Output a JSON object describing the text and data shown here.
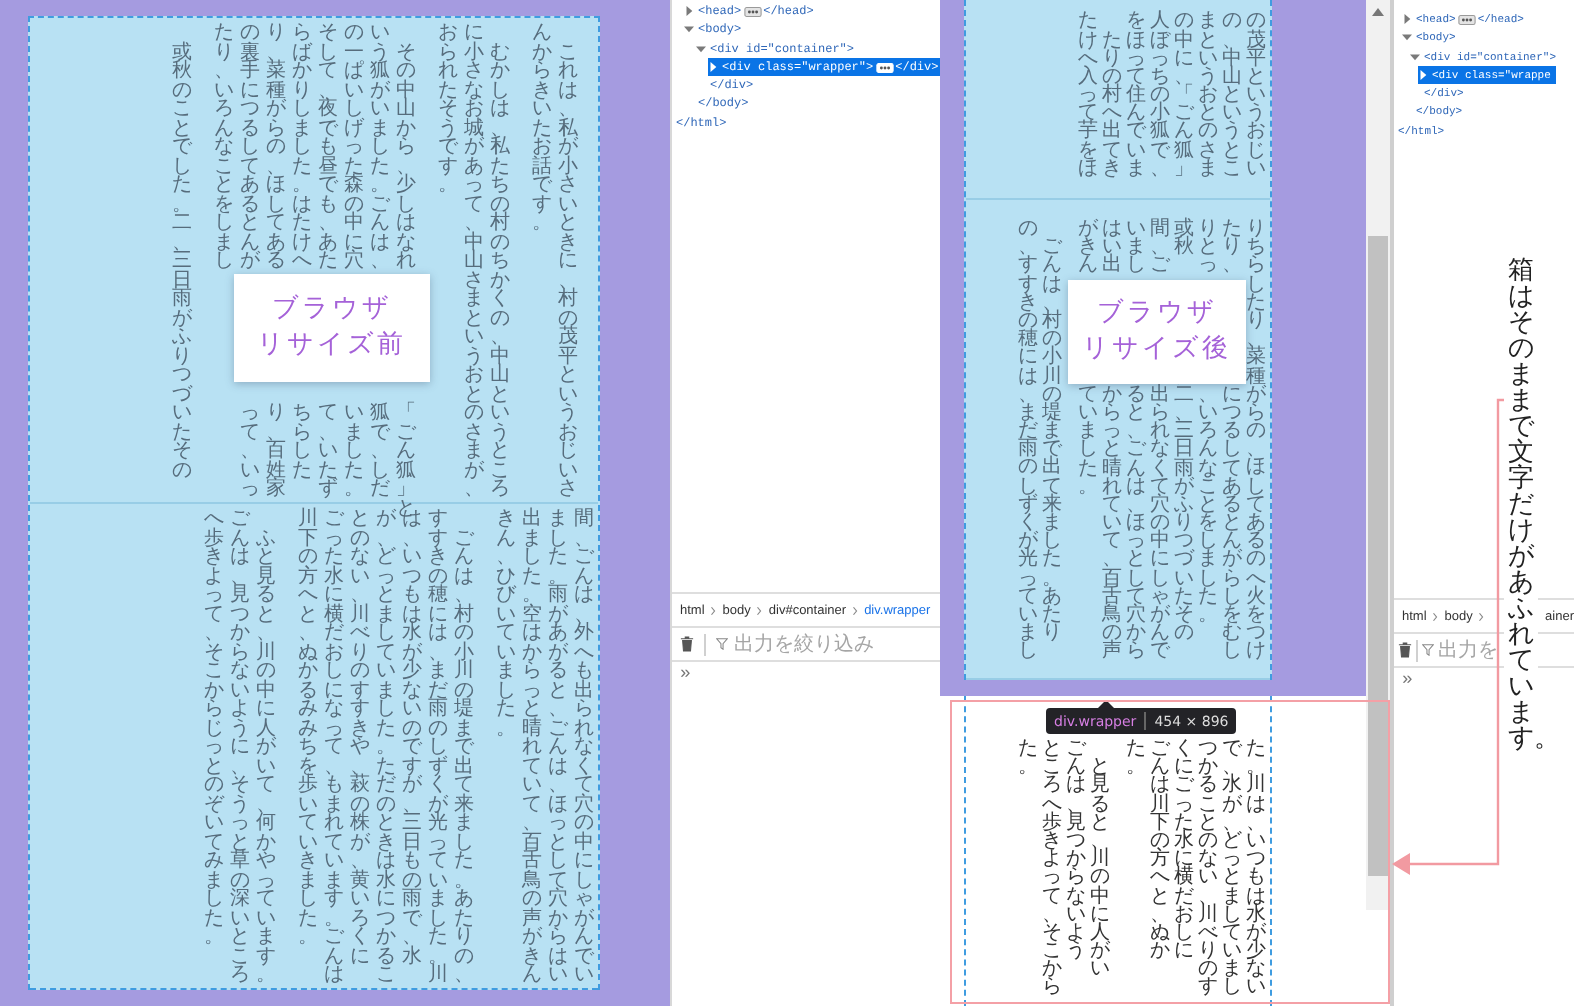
{
  "before_view": {
    "label": [
      "ブラウザ",
      "リサイズ前"
    ],
    "pages": [
      {
        "scrolled": false,
        "columns": [
          {
            "indented": true,
            "parts": [
              "或秋のことでした。二、三日雨がふりつづいたその"
            ]
          },
          {
            "indented": false,
            "parts": [
              "たり、いろんなことをしまし"
            ]
          },
          {
            "indented": false,
            "parts": [
              "の裏手につるしてあるとんが",
              "って、いっ"
            ]
          },
          {
            "indented": false,
            "parts": [
              "り、菜種がらの、ほしてある",
              "り、百姓家"
            ]
          },
          {
            "indented": false,
            "parts": [
              "らばかりしました。はたけへ",
              "ちらした"
            ]
          },
          {
            "indented": false,
            "parts": [
              "そして、夜でも昼でも、あた",
              "て、いたず"
            ]
          },
          {
            "indented": false,
            "parts": [
              "の一ぱいしげった森の中に穴",
              "いました。"
            ]
          },
          {
            "indented": false,
            "parts": [
              "いう狐がいました。ごんは、",
              "狐で、しだ"
            ]
          },
          {
            "indented": true,
            "parts": [
              "その中山から、少しはなれ",
              "「ごん狐」と"
            ]
          },
          {
            "indented": false,
            "parts": [
              "おられたそうです。"
            ]
          },
          {
            "indented": false,
            "parts": [
              "に小さなお城があって、中山さまというおとのさまが、"
            ]
          },
          {
            "indented": true,
            "parts": [
              "むかしは、私たちの村のちかくの、中山というところ"
            ]
          },
          {
            "indented": false,
            "parts": [
              "んからきいたお話です。"
            ]
          },
          {
            "indented": true,
            "parts": [
              "これは、私が小さいときに、村の茂平というおじいさ"
            ]
          }
        ]
      },
      {
        "scrolled": false,
        "columns": [
          {
            "indented": false,
            "parts": [
              "へ歩きよって、そこからじっとのぞいてみました。"
            ]
          },
          {
            "indented": false,
            "parts": [
              "ごんは、見つからないように、そうっと草の深いところ"
            ]
          },
          {
            "indented": true,
            "parts": [
              "ふと見ると、川の中に人がいて、何かやっています。"
            ]
          },
          {
            "indented": false,
            "parts": [
              "川下の方へと、ぬかるみみちを歩いていきました。"
            ]
          },
          {
            "indented": false,
            "parts": [
              "ごった水に横だおしになって、もまれています。ごんは"
            ]
          },
          {
            "indented": false,
            "parts": [
              "とのない、川べりのすすきや、萩の株が、黄いろくに"
            ]
          },
          {
            "indented": false,
            "parts": [
              "が、どっとましていました。ただのときは水につかるこ"
            ]
          },
          {
            "indented": false,
            "parts": [
              "は、いつもは水が少ないのですが、三日もの雨で、水"
            ]
          },
          {
            "indented": false,
            "parts": [
              "すすきの穂には、まだ雨のしずくが光っていました。川"
            ]
          },
          {
            "indented": true,
            "parts": [
              "ごんは、村の小川の堤まで出て来ました。あたりの、"
            ]
          },
          {
            "indented": false,
            "parts": [
              "きん、ひびいていました。"
            ]
          },
          {
            "indented": false,
            "parts": [
              "出ました。空はからっと晴れていて、百舌鳥の声がきん"
            ]
          },
          {
            "indented": false,
            "parts": [
              "ました。雨があがると、ごんは、ほっとして穴からはい"
            ]
          },
          {
            "indented": false,
            "parts": [
              "間、ごんは、外へも出られなくて穴の中にしゃがんでい"
            ]
          }
        ]
      }
    ]
  },
  "devtools_left": {
    "dom_tree": {
      "children": [
        {
          "open": "<head>",
          "close": "</head>",
          "badge": true,
          "expanded": false,
          "selected": false
        },
        {
          "open": "<body>",
          "expanded": true,
          "selected": false,
          "end": "</body>",
          "children": [
            {
              "open": "<div id=\"container\">",
              "expanded": true,
              "selected": false,
              "end": "</div>",
              "children": [
                {
                  "open": "<div class=\"wrapper\">",
                  "close": "</div>",
                  "badge": true,
                  "expanded": false,
                  "selected": true
                }
              ]
            }
          ]
        }
      ],
      "end": "</html>"
    },
    "breadcrumbs": [
      {
        "label": "html",
        "selected": false
      },
      {
        "label": "body",
        "selected": false
      },
      {
        "label": "div#container",
        "selected": false
      },
      {
        "label": "div.wrapper",
        "selected": true
      }
    ],
    "filter_placeholder": "出力を絞り込み",
    "prompt": "»"
  },
  "after_view": {
    "label": [
      "ブラウザ",
      "リサイズ後"
    ],
    "pages": [
      {
        "scrolled": true,
        "columns": [
          {
            "parts": [
              "たけへ入って芋をほ"
            ]
          },
          {
            "parts": [
              "たりの村へ出てき"
            ]
          },
          {
            "parts": [
              "をほって住んでいま"
            ]
          },
          {
            "parts": [
              "人ぼっちの小狐で、"
            ]
          },
          {
            "parts": [
              "の中に、「ごん狐」"
            ]
          },
          {
            "parts": [
              "まというおとのさま"
            ]
          },
          {
            "parts": [
              "の、中山というとこ"
            ]
          },
          {
            "parts": [
              "の茂平というおじい"
            ]
          }
        ]
      },
      {
        "scrolled": false,
        "columns": [
          {
            "indented": false,
            "parts": [
              "の、すすきの穂には、まだ雨のしずくが光っていまし"
            ]
          },
          {
            "indented": true,
            "parts": [
              "ごんは、村の小川の堤まで出て来ました。あたり"
            ]
          },
          {
            "indented": false,
            "parts": [
              "がきん",
              "ていました。"
            ]
          },
          {
            "indented": false,
            "parts": [
              "はい出",
              "からっと晴れていて、百舌鳥の声"
            ]
          },
          {
            "indented": false,
            "parts": [
              "いまし",
              "ると、ごんは、ほっとして穴から"
            ]
          },
          {
            "indented": false,
            "parts": [
              "間、ご",
              "出られなくて穴の中にしゃがんで"
            ]
          },
          {
            "parts": [
              "或秋",
              "。二、三日雨がふりつづいたその"
            ]
          },
          {
            "indented": false,
            "parts": [
              "りとっ",
              "、いろんなことをしました。"
            ]
          },
          {
            "indented": false,
            "parts": [
              "たり、",
              "につるしてあるとんがらしをむし"
            ]
          },
          {
            "indented": false,
            "parts": [
              "りちらしたり、菜種がらの、ほしてあるのへ火をつけ"
            ]
          }
        ]
      }
    ],
    "overflow_columns": [
      {
        "indented": false,
        "parts": [
          "た。"
        ]
      },
      {
        "indented": false,
        "parts": [
          "ところへ歩きよって、そこから"
        ]
      },
      {
        "indented": false,
        "parts": [
          "ごんは、見つからないよう"
        ]
      },
      {
        "indented": true,
        "parts": [
          "と見ると、川の中に人がい"
        ]
      },
      {
        "indented": false,
        "parts": [
          "た。"
        ]
      },
      {
        "indented": false,
        "parts": [
          "ごんは川下の方へと、ぬか"
        ]
      },
      {
        "indented": false,
        "parts": [
          "くにごった水に横だおしに"
        ]
      },
      {
        "indented": false,
        "parts": [
          "つかることのない、川べりのす"
        ]
      },
      {
        "indented": false,
        "parts": [
          "で、水が、どっとましていまし"
        ]
      },
      {
        "indented": false,
        "parts": [
          "た。川は、いつもは水が少ない"
        ]
      }
    ],
    "tooltip": {
      "selector": "div.wrapper",
      "size": "454 × 896"
    }
  },
  "devtools_right": {
    "dom_tree": {
      "children": [
        {
          "open": "<head>",
          "close": "</head>",
          "badge": true,
          "expanded": false,
          "selected": false
        },
        {
          "open": "<body>",
          "expanded": true,
          "selected": false,
          "end": "</body>",
          "children": [
            {
              "open": "<div id=\"container\">",
              "expanded": true,
              "selected": false,
              "end": "</div>",
              "children": [
                {
                  "open": "<div class=\"wrappe",
                  "expanded": false,
                  "selected": true
                }
              ]
            }
          ]
        }
      ],
      "end": "</html>"
    },
    "breadcrumbs": [
      {
        "label": "html",
        "selected": false
      },
      {
        "label": "body",
        "selected": false
      },
      {
        "label": "ainer",
        "selected": false
      }
    ],
    "filter_placeholder": "出力を",
    "prompt": "»"
  },
  "annotation": "箱はそのままで文字だけがあふれています。"
}
